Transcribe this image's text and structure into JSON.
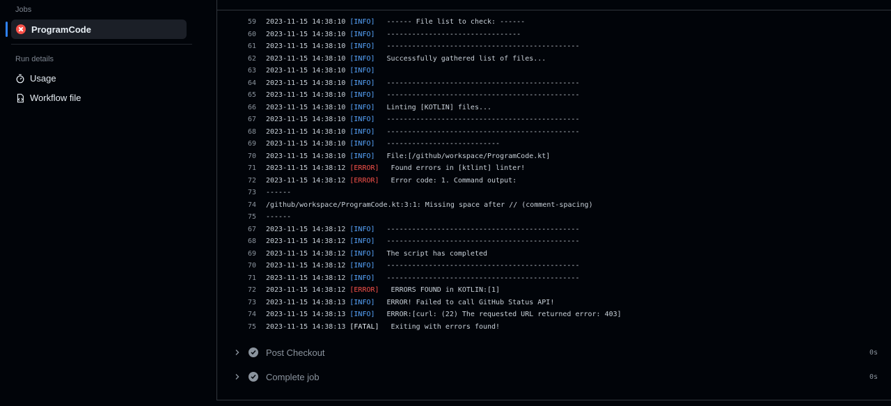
{
  "sidebar": {
    "jobs_label": "Jobs",
    "job": {
      "name": "ProgramCode",
      "status": "failed"
    },
    "run_details_label": "Run details",
    "links": [
      {
        "label": "Usage",
        "icon": "stopwatch-icon"
      },
      {
        "label": "Workflow file",
        "icon": "file-code-icon"
      }
    ]
  },
  "log": [
    {
      "n": "59",
      "ts": "2023-11-15 14:38:10",
      "lvl": "[INFO]",
      "type": "info",
      "msg": "------ File list to check: ------"
    },
    {
      "n": "60",
      "ts": "2023-11-15 14:38:10",
      "lvl": "[INFO]",
      "type": "info",
      "msg": "--------------------------------"
    },
    {
      "n": "61",
      "ts": "2023-11-15 14:38:10",
      "lvl": "[INFO]",
      "type": "info",
      "msg": "----------------------------------------------"
    },
    {
      "n": "62",
      "ts": "2023-11-15 14:38:10",
      "lvl": "[INFO]",
      "type": "info",
      "msg": "Successfully gathered list of files..."
    },
    {
      "n": "63",
      "ts": "2023-11-15 14:38:10",
      "lvl": "[INFO]",
      "type": "info",
      "msg": ""
    },
    {
      "n": "64",
      "ts": "2023-11-15 14:38:10",
      "lvl": "[INFO]",
      "type": "info",
      "msg": "----------------------------------------------"
    },
    {
      "n": "65",
      "ts": "2023-11-15 14:38:10",
      "lvl": "[INFO]",
      "type": "info",
      "msg": "----------------------------------------------"
    },
    {
      "n": "66",
      "ts": "2023-11-15 14:38:10",
      "lvl": "[INFO]",
      "type": "info",
      "msg": "Linting [KOTLIN] files..."
    },
    {
      "n": "67",
      "ts": "2023-11-15 14:38:10",
      "lvl": "[INFO]",
      "type": "info",
      "msg": "----------------------------------------------"
    },
    {
      "n": "68",
      "ts": "2023-11-15 14:38:10",
      "lvl": "[INFO]",
      "type": "info",
      "msg": "----------------------------------------------"
    },
    {
      "n": "69",
      "ts": "2023-11-15 14:38:10",
      "lvl": "[INFO]",
      "type": "info",
      "msg": "---------------------------"
    },
    {
      "n": "70",
      "ts": "2023-11-15 14:38:10",
      "lvl": "[INFO]",
      "type": "info",
      "msg": "File:[/github/workspace/ProgramCode.kt]"
    },
    {
      "n": "71",
      "ts": "2023-11-15 14:38:12",
      "lvl": "[ERROR]",
      "type": "error",
      "msg": "Found errors in [ktlint] linter!"
    },
    {
      "n": "72",
      "ts": "2023-11-15 14:38:12",
      "lvl": "[ERROR]",
      "type": "error",
      "msg": "Error code: 1. Command output:"
    },
    {
      "n": "73",
      "plain": "------"
    },
    {
      "n": "74",
      "plain": "/github/workspace/ProgramCode.kt:3:1: Missing space after // (comment-spacing)"
    },
    {
      "n": "75",
      "plain": "------"
    },
    {
      "n": "67",
      "ts": "2023-11-15 14:38:12",
      "lvl": "[INFO]",
      "type": "info",
      "msg": "----------------------------------------------"
    },
    {
      "n": "68",
      "ts": "2023-11-15 14:38:12",
      "lvl": "[INFO]",
      "type": "info",
      "msg": "----------------------------------------------"
    },
    {
      "n": "69",
      "ts": "2023-11-15 14:38:12",
      "lvl": "[INFO]",
      "type": "info",
      "msg": "The script has completed"
    },
    {
      "n": "70",
      "ts": "2023-11-15 14:38:12",
      "lvl": "[INFO]",
      "type": "info",
      "msg": "----------------------------------------------"
    },
    {
      "n": "71",
      "ts": "2023-11-15 14:38:12",
      "lvl": "[INFO]",
      "type": "info",
      "msg": "----------------------------------------------"
    },
    {
      "n": "72",
      "ts": "2023-11-15 14:38:12",
      "lvl": "[ERROR]",
      "type": "error",
      "msg": "ERRORS FOUND in KOTLIN:[1]"
    },
    {
      "n": "73",
      "ts": "2023-11-15 14:38:13",
      "lvl": "[INFO]",
      "type": "info",
      "msg": "ERROR! Failed to call GitHub Status API!"
    },
    {
      "n": "74",
      "ts": "2023-11-15 14:38:13",
      "lvl": "[INFO]",
      "type": "info",
      "msg": "ERROR:[curl: (22) The requested URL returned error: 403]"
    },
    {
      "n": "75",
      "ts": "2023-11-15 14:38:13",
      "lvl": "[FATAL]",
      "type": "fatal",
      "msg": "Exiting with errors found!"
    }
  ],
  "steps": [
    {
      "label": "Post Checkout",
      "duration": "0s"
    },
    {
      "label": "Complete job",
      "duration": "0s"
    }
  ]
}
